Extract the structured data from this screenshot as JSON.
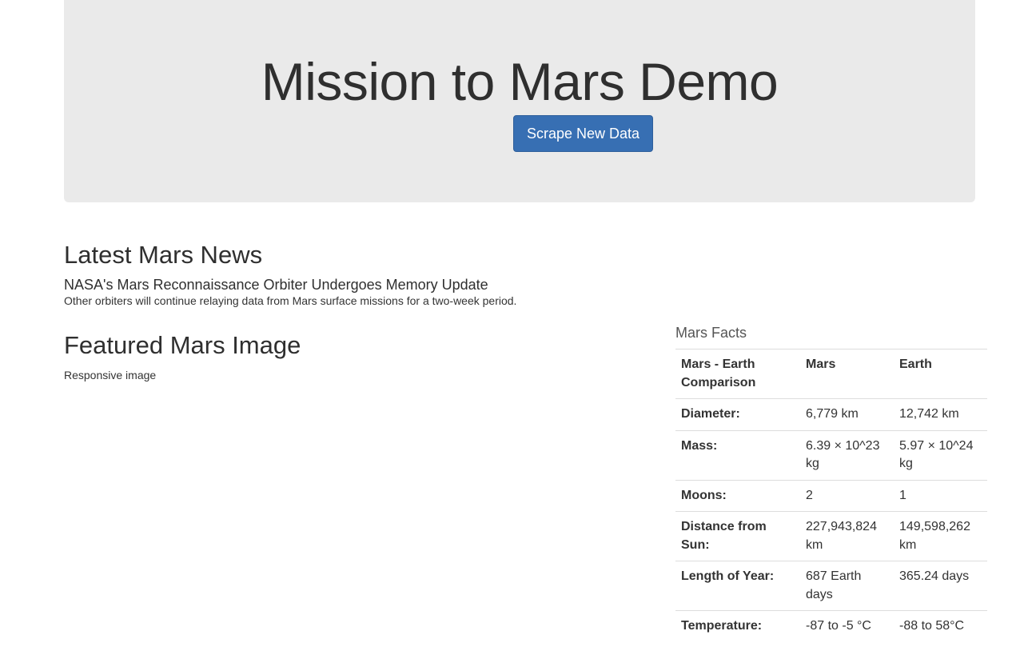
{
  "jumbotron": {
    "title": "Mission to Mars Demo",
    "button_label": "Scrape New Data"
  },
  "news": {
    "heading": "Latest Mars News",
    "title": "NASA's Mars Reconnaissance Orbiter Undergoes Memory Update",
    "teaser": "Other orbiters will continue relaying data from Mars surface missions for a two-week period."
  },
  "featured": {
    "heading": "Featured Mars Image",
    "image_alt": "Responsive image"
  },
  "facts": {
    "caption": "Mars Facts",
    "headers": [
      "Mars - Earth Comparison",
      "Mars",
      "Earth"
    ],
    "rows": [
      [
        "Diameter:",
        "6,779 km",
        "12,742 km"
      ],
      [
        "Mass:",
        "6.39 × 10^23 kg",
        "5.97 × 10^24 kg"
      ],
      [
        "Moons:",
        "2",
        "1"
      ],
      [
        "Distance from Sun:",
        "227,943,824 km",
        "149,598,262 km"
      ],
      [
        "Length of Year:",
        "687 Earth days",
        "365.24 days"
      ],
      [
        "Temperature:",
        "-87 to -5 °C",
        "-88 to 58°C"
      ]
    ]
  }
}
